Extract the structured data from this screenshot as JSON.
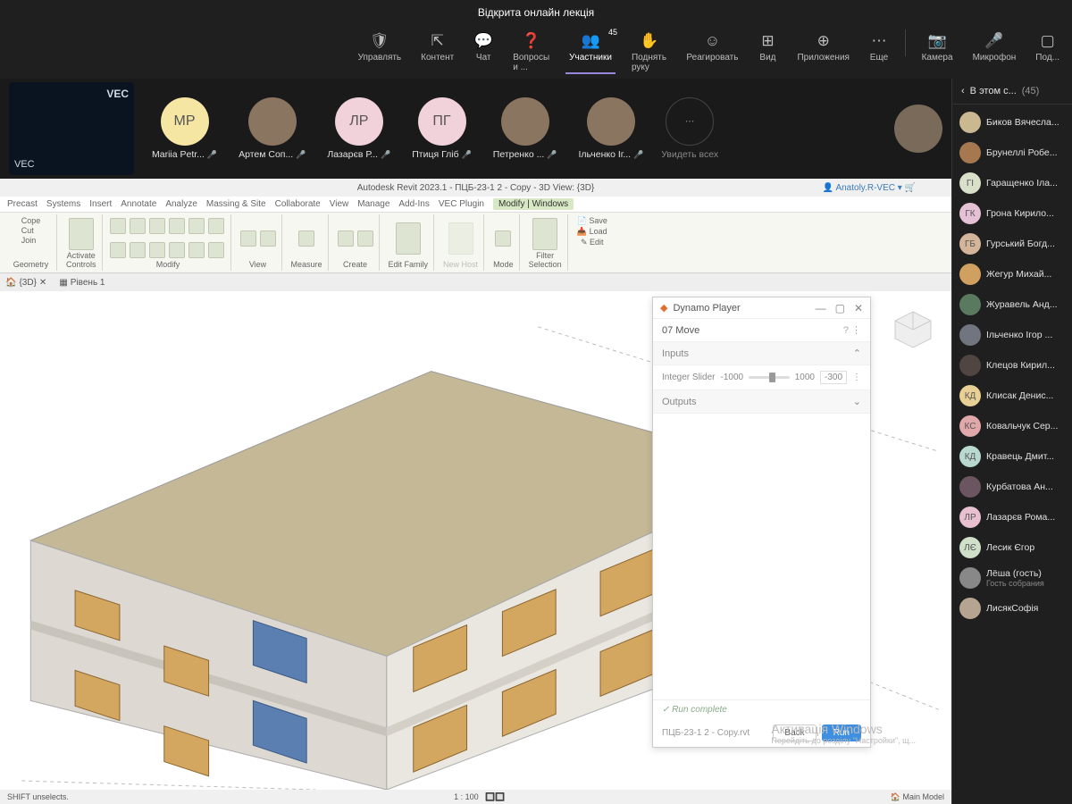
{
  "meeting": {
    "title": "Відкрита онлайн лекція",
    "toolbar": {
      "manage": "Управлять",
      "content": "Контент",
      "chat": "Чат",
      "qa": "Вопросы и ...",
      "participants": "Участники",
      "participants_count": "45",
      "raise_hand": "Поднять руку",
      "react": "Реагировать",
      "view": "Вид",
      "apps": "Приложения",
      "more": "Еще",
      "camera": "Камера",
      "microphone": "Микрофон",
      "share": "Под..."
    },
    "logo": "VEC",
    "video_strip": [
      {
        "initials": "МР",
        "name": "Mariia Petr...",
        "color": "yellow"
      },
      {
        "initials": "",
        "name": "Артем Соп...",
        "color": "photo"
      },
      {
        "initials": "ЛР",
        "name": "Лазарєв Р...",
        "color": "pink"
      },
      {
        "initials": "ПГ",
        "name": "Птиця Гліб",
        "color": "pink"
      },
      {
        "initials": "",
        "name": "Петренко ...",
        "color": "photo"
      },
      {
        "initials": "",
        "name": "Ільченко Іг...",
        "color": "photo"
      }
    ],
    "view_all": "Увидеть всех"
  },
  "revit": {
    "title": "Autodesk Revit 2023.1 - ПЦБ-23-1 2 - Copy - 3D View: {3D}",
    "user": "Anatoly.R-VEC",
    "tabs": [
      "Precast",
      "Systems",
      "Insert",
      "Annotate",
      "Analyze",
      "Massing & Site",
      "Collaborate",
      "View",
      "Manage",
      "Add-Ins",
      "VEC Plugin"
    ],
    "active_tab": "Modify | Windows",
    "ribbon_groups": [
      "Geometry",
      "Controls",
      "Modify",
      "View",
      "Measure",
      "Create",
      "Edit Family",
      "New Host",
      "Mode",
      "Host",
      "Selection"
    ],
    "secondary_labels": {
      "copy": "Cope",
      "cut": "Cut",
      "join": "Join",
      "activate": "Activate",
      "save": "Save",
      "load": "Load",
      "edit": "Edit",
      "filter": "Filter"
    },
    "view_tabs": {
      "tab1": "{3D}",
      "tab2": "Рівень 1"
    },
    "status_left": "SHIFT unselects.",
    "status_model": "Main Model",
    "scale": "1 : 100"
  },
  "dynamo": {
    "title": "Dynamo Player",
    "script_name": "07 Move",
    "inputs": "Inputs",
    "slider_label": "Integer Slider",
    "slider_min": "-1000",
    "slider_max": "1000",
    "slider_value": "-300",
    "outputs": "Outputs",
    "status": "Run complete",
    "filename": "ПЦБ-23-1 2 - Copy.rvt",
    "back": "Back",
    "run": "Run"
  },
  "panel": {
    "title": "В этом с...",
    "count": "(45)",
    "list": [
      {
        "initials": "",
        "name": "Биков Вячесла...",
        "color": "#c9b890"
      },
      {
        "initials": "",
        "name": "Брунеллі Робе...",
        "color": "#a67850"
      },
      {
        "initials": "ГІ",
        "name": "Гаращенко Іла...",
        "color": "#d9e0c9"
      },
      {
        "initials": "ГК",
        "name": "Грона Кирило...",
        "color": "#e5c1d5"
      },
      {
        "initials": "ГБ",
        "name": "Гурський Богд...",
        "color": "#d4b59a"
      },
      {
        "initials": "",
        "name": "Жегур Михай...",
        "color": "#d0a060"
      },
      {
        "initials": "",
        "name": "Журавель Анд...",
        "color": "#5a7a60"
      },
      {
        "initials": "",
        "name": "Ільченко Ігор ...",
        "color": "#707580"
      },
      {
        "initials": "",
        "name": "Клецов Кирил...",
        "color": "#504540"
      },
      {
        "initials": "КД",
        "name": "Клисак Денис...",
        "color": "#e8d095"
      },
      {
        "initials": "КС",
        "name": "Ковальчук Сер...",
        "color": "#e0a8a8"
      },
      {
        "initials": "КД",
        "name": "Кравець Дмит...",
        "color": "#b8d8d0"
      },
      {
        "initials": "",
        "name": "Курбатова Ан...",
        "color": "#6a5560"
      },
      {
        "initials": "ЛР",
        "name": "Лазарєв Рома...",
        "color": "#e8c0d0"
      },
      {
        "initials": "ЛЄ",
        "name": "Лесик Єгор",
        "color": "#d0e0c8"
      },
      {
        "initials": "",
        "name": "Лёша (гость)",
        "sub": "Гость собрания",
        "color": "#888"
      },
      {
        "initials": "",
        "name": "ЛисякСофія",
        "color": "#b5a590"
      }
    ]
  },
  "watermark": {
    "title": "Активація Windows",
    "sub": "Перейдіть до розділу \"Настройки\", щ..."
  }
}
